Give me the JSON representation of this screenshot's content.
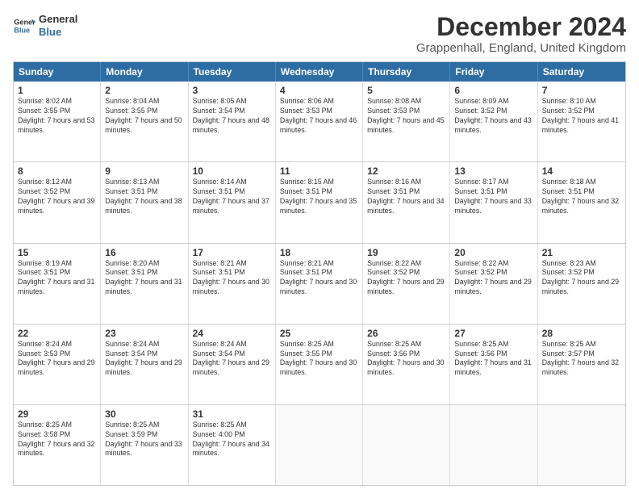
{
  "logo": {
    "line1": "General",
    "line2": "Blue"
  },
  "title": "December 2024",
  "subtitle": "Grappenhall, England, United Kingdom",
  "days": [
    "Sunday",
    "Monday",
    "Tuesday",
    "Wednesday",
    "Thursday",
    "Friday",
    "Saturday"
  ],
  "weeks": [
    [
      {
        "day": 1,
        "sunrise": "8:02 AM",
        "sunset": "3:55 PM",
        "daylight": "7 hours and 53 minutes."
      },
      {
        "day": 2,
        "sunrise": "8:04 AM",
        "sunset": "3:55 PM",
        "daylight": "7 hours and 50 minutes."
      },
      {
        "day": 3,
        "sunrise": "8:05 AM",
        "sunset": "3:54 PM",
        "daylight": "7 hours and 48 minutes."
      },
      {
        "day": 4,
        "sunrise": "8:06 AM",
        "sunset": "3:53 PM",
        "daylight": "7 hours and 46 minutes."
      },
      {
        "day": 5,
        "sunrise": "8:08 AM",
        "sunset": "3:53 PM",
        "daylight": "7 hours and 45 minutes."
      },
      {
        "day": 6,
        "sunrise": "8:09 AM",
        "sunset": "3:52 PM",
        "daylight": "7 hours and 43 minutes."
      },
      {
        "day": 7,
        "sunrise": "8:10 AM",
        "sunset": "3:52 PM",
        "daylight": "7 hours and 41 minutes."
      }
    ],
    [
      {
        "day": 8,
        "sunrise": "8:12 AM",
        "sunset": "3:52 PM",
        "daylight": "7 hours and 39 minutes."
      },
      {
        "day": 9,
        "sunrise": "8:13 AM",
        "sunset": "3:51 PM",
        "daylight": "7 hours and 38 minutes."
      },
      {
        "day": 10,
        "sunrise": "8:14 AM",
        "sunset": "3:51 PM",
        "daylight": "7 hours and 37 minutes."
      },
      {
        "day": 11,
        "sunrise": "8:15 AM",
        "sunset": "3:51 PM",
        "daylight": "7 hours and 35 minutes."
      },
      {
        "day": 12,
        "sunrise": "8:16 AM",
        "sunset": "3:51 PM",
        "daylight": "7 hours and 34 minutes."
      },
      {
        "day": 13,
        "sunrise": "8:17 AM",
        "sunset": "3:51 PM",
        "daylight": "7 hours and 33 minutes."
      },
      {
        "day": 14,
        "sunrise": "8:18 AM",
        "sunset": "3:51 PM",
        "daylight": "7 hours and 32 minutes."
      }
    ],
    [
      {
        "day": 15,
        "sunrise": "8:19 AM",
        "sunset": "3:51 PM",
        "daylight": "7 hours and 31 minutes."
      },
      {
        "day": 16,
        "sunrise": "8:20 AM",
        "sunset": "3:51 PM",
        "daylight": "7 hours and 31 minutes."
      },
      {
        "day": 17,
        "sunrise": "8:21 AM",
        "sunset": "3:51 PM",
        "daylight": "7 hours and 30 minutes."
      },
      {
        "day": 18,
        "sunrise": "8:21 AM",
        "sunset": "3:51 PM",
        "daylight": "7 hours and 30 minutes."
      },
      {
        "day": 19,
        "sunrise": "8:22 AM",
        "sunset": "3:52 PM",
        "daylight": "7 hours and 29 minutes."
      },
      {
        "day": 20,
        "sunrise": "8:22 AM",
        "sunset": "3:52 PM",
        "daylight": "7 hours and 29 minutes."
      },
      {
        "day": 21,
        "sunrise": "8:23 AM",
        "sunset": "3:52 PM",
        "daylight": "7 hours and 29 minutes."
      }
    ],
    [
      {
        "day": 22,
        "sunrise": "8:24 AM",
        "sunset": "3:53 PM",
        "daylight": "7 hours and 29 minutes."
      },
      {
        "day": 23,
        "sunrise": "8:24 AM",
        "sunset": "3:54 PM",
        "daylight": "7 hours and 29 minutes."
      },
      {
        "day": 24,
        "sunrise": "8:24 AM",
        "sunset": "3:54 PM",
        "daylight": "7 hours and 29 minutes."
      },
      {
        "day": 25,
        "sunrise": "8:25 AM",
        "sunset": "3:55 PM",
        "daylight": "7 hours and 30 minutes."
      },
      {
        "day": 26,
        "sunrise": "8:25 AM",
        "sunset": "3:56 PM",
        "daylight": "7 hours and 30 minutes."
      },
      {
        "day": 27,
        "sunrise": "8:25 AM",
        "sunset": "3:56 PM",
        "daylight": "7 hours and 31 minutes."
      },
      {
        "day": 28,
        "sunrise": "8:25 AM",
        "sunset": "3:57 PM",
        "daylight": "7 hours and 32 minutes."
      }
    ],
    [
      {
        "day": 29,
        "sunrise": "8:25 AM",
        "sunset": "3:58 PM",
        "daylight": "7 hours and 32 minutes."
      },
      {
        "day": 30,
        "sunrise": "8:25 AM",
        "sunset": "3:59 PM",
        "daylight": "7 hours and 33 minutes."
      },
      {
        "day": 31,
        "sunrise": "8:25 AM",
        "sunset": "4:00 PM",
        "daylight": "7 hours and 34 minutes."
      },
      null,
      null,
      null,
      null
    ]
  ]
}
